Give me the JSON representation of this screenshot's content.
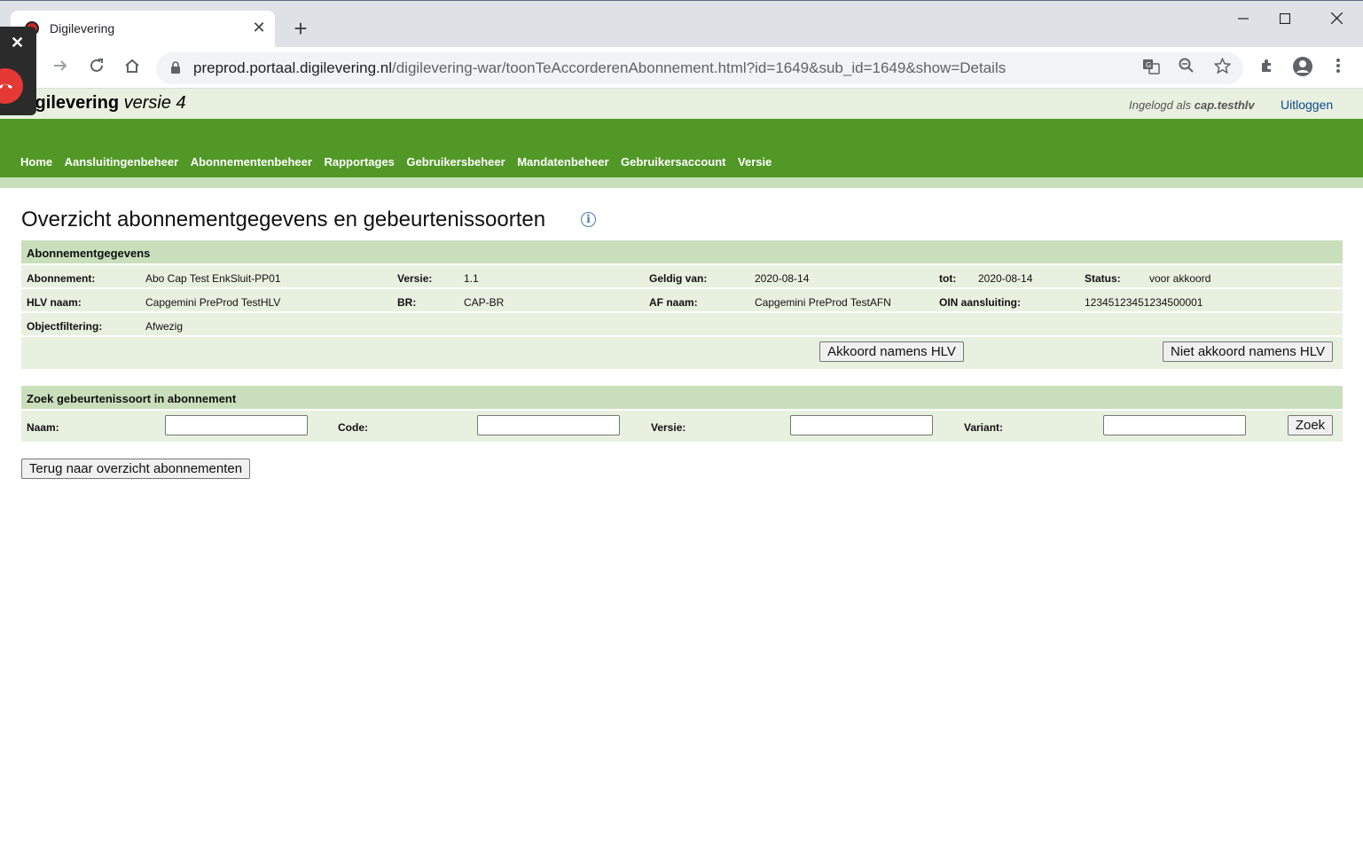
{
  "browser": {
    "tab_title": "Digilevering",
    "tab_close": "✕",
    "new_tab": "+",
    "url_host": "preprod.portaal.digilevering.nl",
    "url_path": "/digilevering-war/toonTeAccorderenAbonnement.html?id=1649&sub_id=1649&show=Details",
    "window": {
      "minimize": "—",
      "maximize": "☐",
      "close": "✕"
    }
  },
  "header": {
    "brand_bold": "igilevering",
    "brand_italic": " versie 4",
    "login_prefix": "Ingelogd als ",
    "login_user": "cap.testhlv",
    "logout": "Uitloggen"
  },
  "nav": {
    "items": [
      "Home",
      "Aansluitingenbeheer",
      "Abonnementenbeheer",
      "Rapportages",
      "Gebruikersbeheer",
      "Mandatenbeheer",
      "Gebruikersaccount",
      "Versie"
    ]
  },
  "page": {
    "title": "Overzicht abonnementgegevens en gebeurtenissoorten",
    "info_icon": "i"
  },
  "abonnement": {
    "heading": "Abonnementgegevens",
    "abonnement_label": "Abonnement:",
    "abonnement_value": "Abo Cap Test EnkSluit-PP01",
    "versie_label": "Versie:",
    "versie_value": "1.1",
    "geldig_label": "Geldig van:",
    "geldig_value": "2020-08-14",
    "tot_label": "tot:",
    "tot_value": "2020-08-14",
    "status_label": "Status:",
    "status_value": "voor akkoord",
    "hlv_label": "HLV naam:",
    "hlv_value": "Capgemini PreProd TestHLV",
    "br_label": "BR:",
    "br_value": "CAP-BR",
    "af_label": "AF naam:",
    "af_value": "Capgemini PreProd TestAFN",
    "oin_label": "OIN aansluiting:",
    "oin_value": "12345123451234500001",
    "objectfilter_label": "Objectfiltering:",
    "objectfilter_value": "Afwezig",
    "akkoord_button": "Akkoord namens HLV",
    "niet_akkoord_button": "Niet akkoord namens HLV"
  },
  "zoek": {
    "heading": "Zoek gebeurtenissoort in abonnement",
    "naam_label": "Naam:",
    "code_label": "Code:",
    "versie_label": "Versie:",
    "variant_label": "Variant:",
    "naam_value": "",
    "code_value": "",
    "versie_value": "",
    "variant_value": "",
    "search_button": "Zoek"
  },
  "back_button": "Terug naar overzicht abonnementen"
}
